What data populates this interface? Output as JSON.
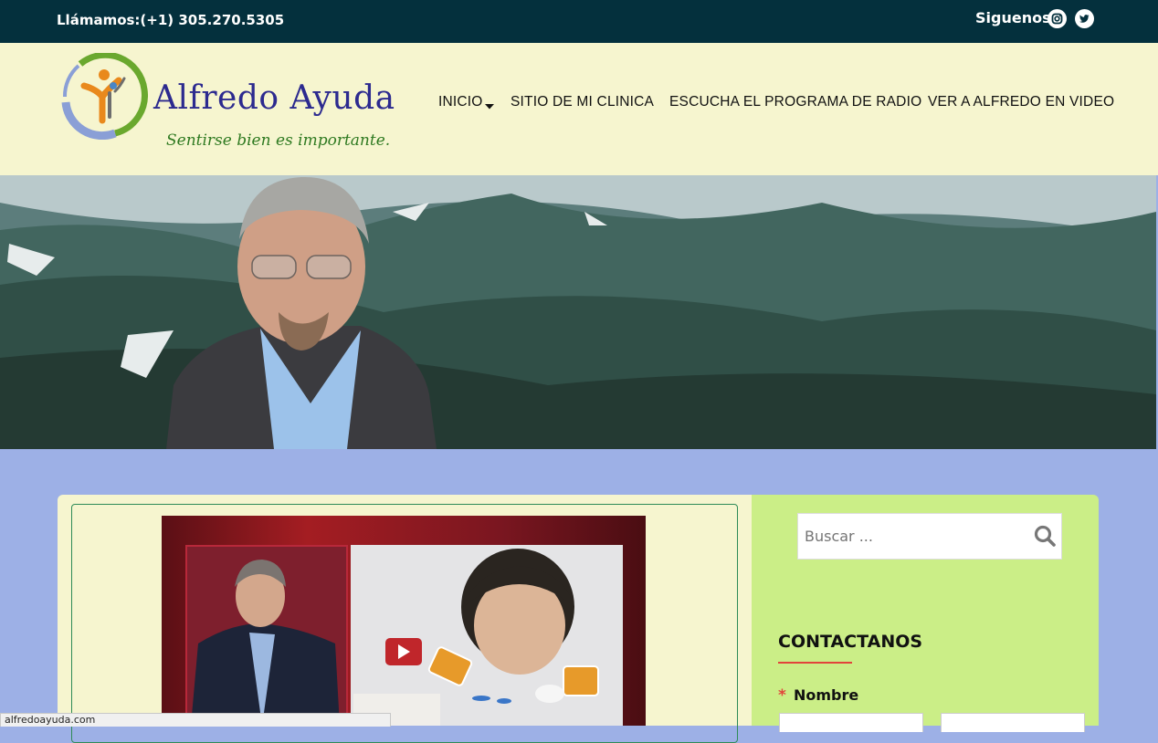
{
  "topbar": {
    "phone": "Llámamos:(+1) 305.270.5305",
    "follow": "Siguenos",
    "social_icons": [
      "instagram-icon",
      "twitter-icon"
    ]
  },
  "logo": {
    "title": "Alfredo Ayuda",
    "tagline": "Sentirse bien es importante."
  },
  "nav": {
    "items": [
      "INICIO",
      "SITIO DE MI CLINICA",
      "ESCUCHA EL PROGRAMA DE RADIO",
      "VER A ALFREDO EN VIDEO"
    ]
  },
  "sidebar": {
    "search_placeholder": "Buscar ...",
    "contact_title": "CONTACTANOS",
    "required_mark": "*",
    "name_label": "Nombre"
  },
  "status": {
    "url": "alfredoayuda.com"
  },
  "colors": {
    "topbar": "#04303d",
    "header": "#f6f5cf",
    "page_bg": "#9db0e6",
    "sidebar": "#cbee87",
    "accent_red": "#e2443b",
    "logo_blue": "#2c2a8f",
    "logo_green": "#2f7a21"
  }
}
